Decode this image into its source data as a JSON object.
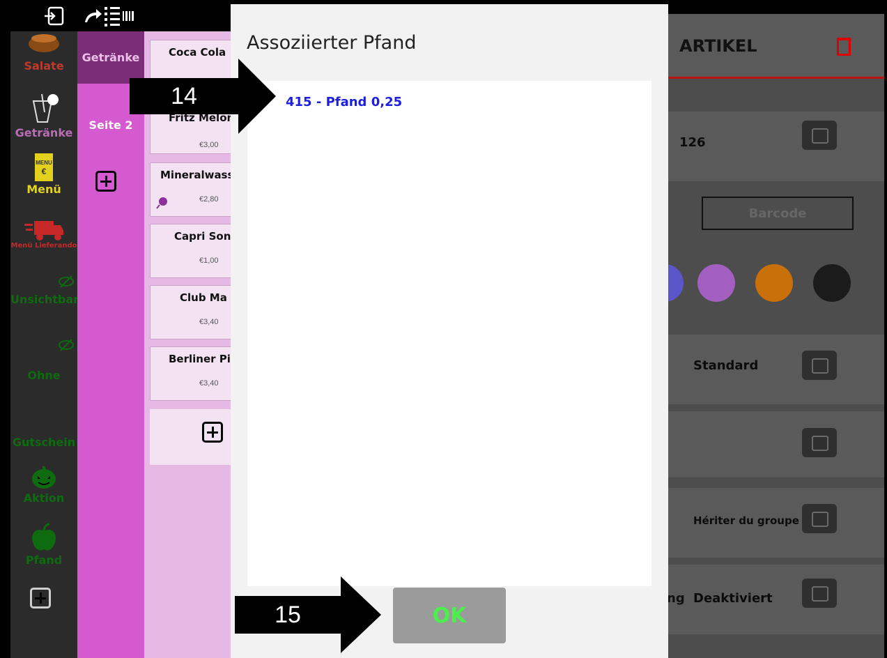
{
  "categories": [
    {
      "label": "Salate",
      "color": "#c0392b",
      "icon": "bowl-icon"
    },
    {
      "label": "Getränke",
      "color": "#b86db5",
      "icon": "drink-icon"
    },
    {
      "label": "Menü",
      "color": "#e2d21e",
      "icon": "menu-card-icon"
    },
    {
      "label": "Menü Lieferando",
      "color": "#c62828",
      "icon": "delivery-truck-icon"
    },
    {
      "label": "Unsichtbar",
      "color": "#0f6b0f",
      "icon": "eye-slash-icon"
    },
    {
      "label": "Ohne",
      "color": "#0f6b0f",
      "icon": "eye-slash-icon"
    },
    {
      "label": "Gutschein",
      "color": "#0f6b0f",
      "icon": ""
    },
    {
      "label": "Aktion",
      "color": "#0f6b0f",
      "icon": "pumpkin-icon"
    },
    {
      "label": "Pfand",
      "color": "#0f6b0f",
      "icon": "apple-icon"
    }
  ],
  "group": {
    "name": "Getränke",
    "page": "Seite 2"
  },
  "items": [
    {
      "name": "Coca Cola",
      "price": ""
    },
    {
      "name": "Fritz Melon",
      "price": "€3,00"
    },
    {
      "name": "Mineralwass",
      "price": "€2,80"
    },
    {
      "name": "Capri Son",
      "price": "€1,00"
    },
    {
      "name": "Club Ma",
      "price": "€3,40"
    },
    {
      "name": "Berliner Pi",
      "price": "€3,40"
    }
  ],
  "article_panel": {
    "title": "ARTIKEL",
    "number": "126",
    "barcode_placeholder": "Barcode",
    "color_swatches": [
      "#5b57c9",
      "#a35fc0",
      "#c9700a",
      "#1b1b1b"
    ],
    "printer": "Standard",
    "inherit": "Hériter du groupe",
    "status_prefix": "ng",
    "status": "Deaktiviert"
  },
  "dialog": {
    "title": "Assoziierter Pfand",
    "entries": [
      "415 - Pfand 0,25"
    ],
    "ok_label": "OK"
  },
  "annotations": {
    "step_14": "14",
    "step_15": "15"
  }
}
